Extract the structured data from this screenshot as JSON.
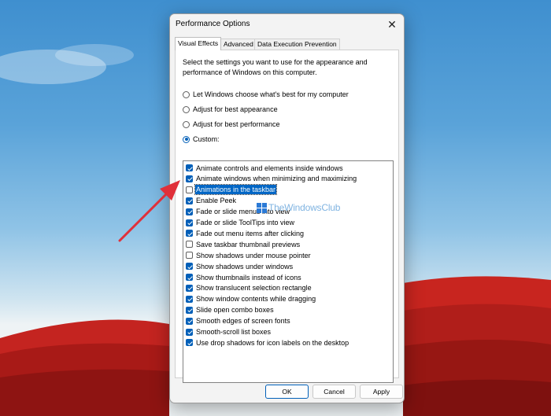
{
  "colors": {
    "accent": "#005fb8",
    "selection": "#0066c5",
    "arrow": "#e0303a",
    "field_red": "#c8221e"
  },
  "window": {
    "title": "Performance Options",
    "close_icon": "close-icon"
  },
  "tabs": [
    {
      "label": "Visual Effects",
      "active": true
    },
    {
      "label": "Advanced",
      "active": false
    },
    {
      "label": "Data Execution Prevention",
      "active": false
    }
  ],
  "panel": {
    "description": "Select the settings you want to use for the appearance and performance of Windows on this computer.",
    "options": [
      {
        "label": "Let Windows choose what's best for my computer",
        "selected": false
      },
      {
        "label": "Adjust for best appearance",
        "selected": false
      },
      {
        "label": "Adjust for best performance",
        "selected": false
      },
      {
        "label": "Custom:",
        "selected": true
      }
    ],
    "effects": [
      {
        "label": "Animate controls and elements inside windows",
        "checked": true
      },
      {
        "label": "Animate windows when minimizing and maximizing",
        "checked": true
      },
      {
        "label": "Animations in the taskbar",
        "checked": false,
        "selected": true
      },
      {
        "label": "Enable Peek",
        "checked": true
      },
      {
        "label": "Fade or slide menus into view",
        "checked": true
      },
      {
        "label": "Fade or slide ToolTips into view",
        "checked": true
      },
      {
        "label": "Fade out menu items after clicking",
        "checked": true
      },
      {
        "label": "Save taskbar thumbnail previews",
        "checked": false
      },
      {
        "label": "Show shadows under mouse pointer",
        "checked": false
      },
      {
        "label": "Show shadows under windows",
        "checked": true
      },
      {
        "label": "Show thumbnails instead of icons",
        "checked": true
      },
      {
        "label": "Show translucent selection rectangle",
        "checked": true
      },
      {
        "label": "Show window contents while dragging",
        "checked": true
      },
      {
        "label": "Slide open combo boxes",
        "checked": true
      },
      {
        "label": "Smooth edges of screen fonts",
        "checked": true
      },
      {
        "label": "Smooth-scroll list boxes",
        "checked": true
      },
      {
        "label": "Use drop shadows for icon labels on the desktop",
        "checked": true
      }
    ]
  },
  "buttons": {
    "ok": "OK",
    "cancel": "Cancel",
    "apply": "Apply"
  },
  "watermark": {
    "text": "TheWindowsClub",
    "icon": "windows-logo-icon"
  }
}
